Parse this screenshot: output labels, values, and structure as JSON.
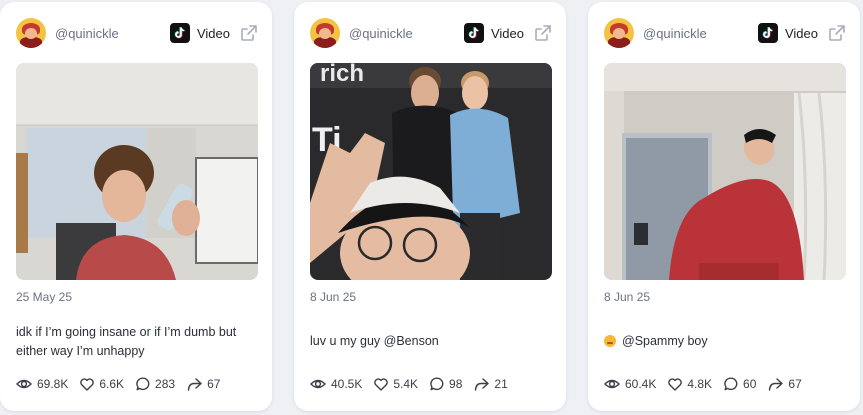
{
  "cards": [
    {
      "username": "@quinickle",
      "platform": "Video",
      "platform_icon": "tiktok-icon",
      "date": "25 May 25",
      "caption": "idk if I’m going insane or if I’m dumb but either way I’m unhappy",
      "stats": {
        "views": "69.8K",
        "likes": "6.6K",
        "comments": "283",
        "shares": "67"
      }
    },
    {
      "username": "@quinickle",
      "platform": "Video",
      "platform_icon": "tiktok-icon",
      "date": "8 Jun 25",
      "caption": "luv u my guy @Benson",
      "stats": {
        "views": "40.5K",
        "likes": "5.4K",
        "comments": "98",
        "shares": "21"
      }
    },
    {
      "username": "@quinickle",
      "platform": "Video",
      "platform_icon": "tiktok-icon",
      "date": "8 Jun 25",
      "caption_emoji": "relieved-face-emoji",
      "caption": "@Spammy boy",
      "stats": {
        "views": "60.4K",
        "likes": "4.8K",
        "comments": "60",
        "shares": "67"
      }
    }
  ]
}
